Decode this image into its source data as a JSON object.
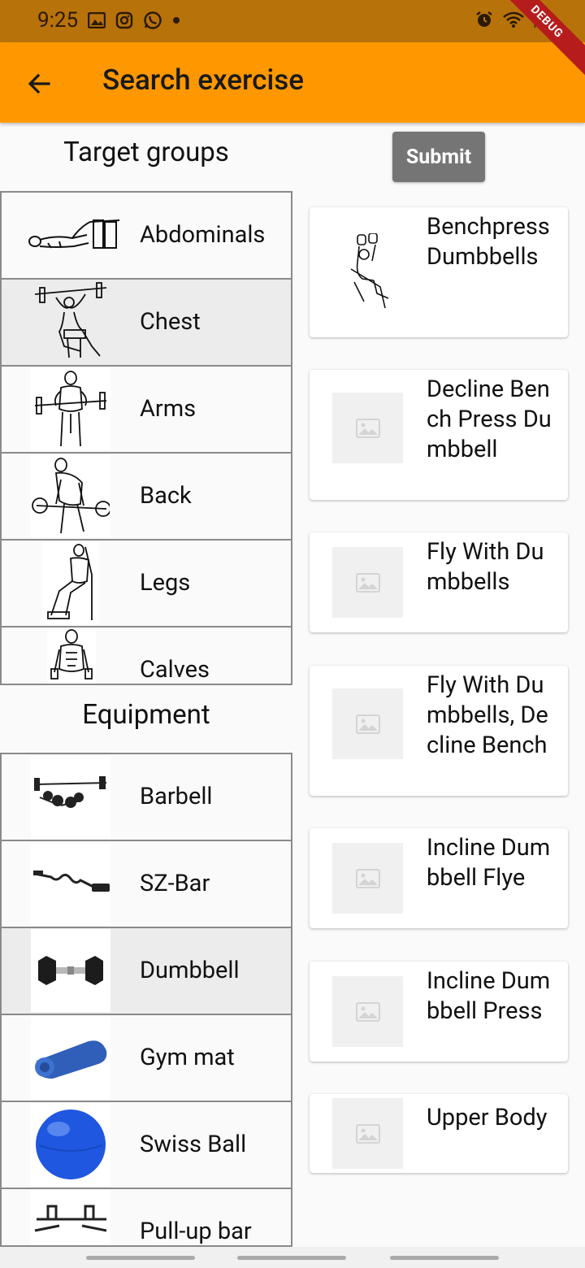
{
  "status_bar": {
    "time": "9:25",
    "debug_banner": "DEBUG"
  },
  "app_bar": {
    "title": "Search exercise"
  },
  "target_groups": {
    "heading": "Target groups",
    "items": [
      {
        "label": "Abdominals",
        "icon": "abdominals-figure"
      },
      {
        "label": "Chest",
        "icon": "chest-figure",
        "selected": true
      },
      {
        "label": "Arms",
        "icon": "arms-figure"
      },
      {
        "label": "Back",
        "icon": "back-figure"
      },
      {
        "label": "Legs",
        "icon": "legs-figure"
      },
      {
        "label": "Calves",
        "icon": "calves-figure"
      }
    ]
  },
  "equipment": {
    "heading": "Equipment",
    "items": [
      {
        "label": "Barbell",
        "icon": "barbell-icon"
      },
      {
        "label": "SZ-Bar",
        "icon": "sz-bar-icon"
      },
      {
        "label": "Dumbbell",
        "icon": "dumbbell-icon",
        "selected": true
      },
      {
        "label": "Gym mat",
        "icon": "gym-mat-icon"
      },
      {
        "label": "Swiss Ball",
        "icon": "swiss-ball-icon"
      },
      {
        "label": "Pull-up bar",
        "icon": "pull-up-bar-icon"
      }
    ]
  },
  "submit": {
    "label": "Submit"
  },
  "results": [
    {
      "label": "Benchpress Dumbbells",
      "image": "benchpress-figure"
    },
    {
      "label": "Decline Bench Press Dumbbell",
      "image": "placeholder"
    },
    {
      "label": "Fly With Dumbbells",
      "image": "placeholder"
    },
    {
      "label": "Fly With Dumbbells, Decline Bench",
      "image": "placeholder"
    },
    {
      "label": "Incline Dumbbell Flye",
      "image": "placeholder"
    },
    {
      "label": "Incline Dumbbell Press",
      "image": "placeholder"
    },
    {
      "label": "Upper Body",
      "image": "placeholder"
    }
  ],
  "colors": {
    "app_bar": "#ff9800",
    "status_bar": "#b8720a",
    "submit": "#757575",
    "selected_row": "#ececec"
  }
}
